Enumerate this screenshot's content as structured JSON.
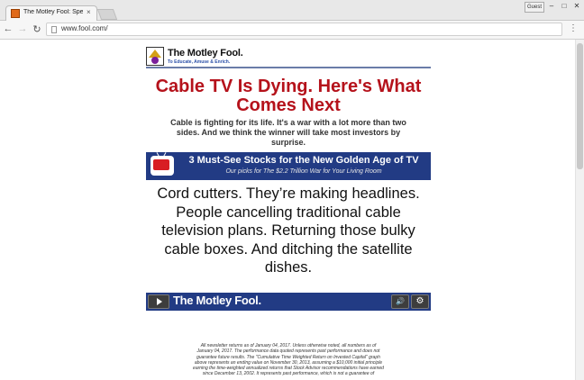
{
  "browser": {
    "tab_title": "The Motley Fool: Specia",
    "tab_close": "×",
    "profile": "Guest",
    "url": "www.fool.com/",
    "window_buttons": {
      "minimize": "–",
      "maximize": "□",
      "close": "✕"
    },
    "nav": {
      "back": "←",
      "forward": "→",
      "reload": "↻",
      "menu": "⋮"
    }
  },
  "page": {
    "logo": {
      "name": "The Motley Fool.",
      "tagline": "To Educate, Amuse & Enrich."
    },
    "headline": "Cable TV Is Dying. Here's What Comes Next",
    "subheadline": "Cable is fighting for its life. It's a war with a lot more than two sides. And we think the winner will take most investors by surprise.",
    "banner": {
      "title": "3 Must-See Stocks for the New Golden Age of TV",
      "subtitle": "Our picks for The $2.2 Trillion War for Your Living Room"
    },
    "body": "Cord cutters. They’re making headlines. People cancelling traditional cable television plans. Returning those bulky cable boxes. And ditching the satellite dishes.",
    "video": {
      "brand": "The Motley Fool.",
      "volume_icon": "🔊",
      "settings_icon": "⚙"
    },
    "disclaimer": "All newsletter returns as of January 04, 2017. Unless otherwise noted, all numbers as of January 04, 2017. The performance data quoted represents past performance and does not guarantee future results. The \"Cumulative Time Weighted Return on Invested Capital\" graph above represents an ending value on November 30, 2013, assuming a $10,000 initial principle earning the time-weighted annualized returns that Stock Advisor recommendations have earned since December 13, 2002. It represents past performance, which is not a guarantee of"
  },
  "colors": {
    "headline_red": "#b5121b",
    "banner_navy": "#223b84",
    "favicon_orange": "#e06a1a"
  },
  "icons": [
    "favicon-icon",
    "page-icon",
    "tv-icon",
    "play-icon",
    "volume-icon",
    "gear-icon"
  ]
}
